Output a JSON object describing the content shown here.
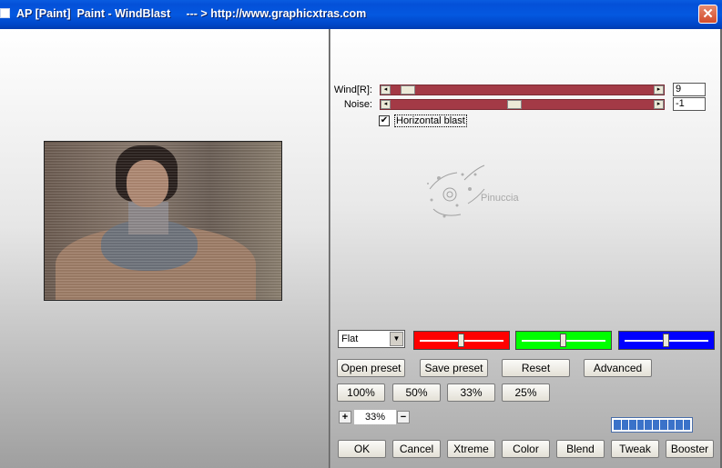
{
  "window": {
    "title": "AP [Paint]  Paint - WindBlast     --- > http://www.graphicxtras.com",
    "close_label": "✕"
  },
  "params": [
    {
      "label": "Wind[R]:",
      "value": "9",
      "fraction": 0.04
    },
    {
      "label": "Noise:",
      "value": "-1",
      "fraction": 0.47
    }
  ],
  "horizontal_blast": {
    "label": "Horizontal blast",
    "checked": true,
    "mark": "✔"
  },
  "watermark": {
    "text": "Pinuccia"
  },
  "preset": {
    "selected": "Flat",
    "arrow": "▼"
  },
  "color_bars": [
    {
      "name": "red",
      "color": "#ff0000",
      "fraction": 0.5
    },
    {
      "name": "green",
      "color": "#00ff00",
      "fraction": 0.5
    },
    {
      "name": "blue",
      "color": "#0000ff",
      "fraction": 0.5
    }
  ],
  "preset_buttons": [
    "Open preset",
    "Save preset",
    "Reset",
    "Advanced"
  ],
  "zoom_buttons": [
    "100%",
    "50%",
    "33%",
    "25%"
  ],
  "zoom": {
    "plus": "+",
    "value": "33%",
    "minus": "−"
  },
  "action_buttons": [
    "OK",
    "Cancel",
    "Xtreme",
    "Color",
    "Blend",
    "Tweak",
    "Booster"
  ],
  "progress": {
    "segments": 10
  }
}
